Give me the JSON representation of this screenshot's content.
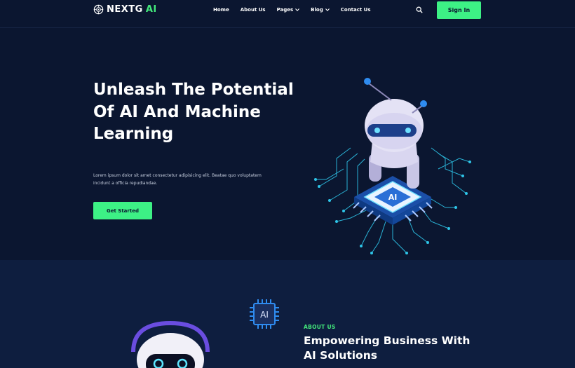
{
  "brand": {
    "name": "NEXTG",
    "suffix": "AI"
  },
  "nav": {
    "items": [
      {
        "label": "Home",
        "has_dropdown": false
      },
      {
        "label": "About Us",
        "has_dropdown": false
      },
      {
        "label": "Pages",
        "has_dropdown": true
      },
      {
        "label": "Blog",
        "has_dropdown": true
      },
      {
        "label": "Contact Us",
        "has_dropdown": false
      }
    ],
    "search_icon": "search-icon",
    "signin_label": "Sign In"
  },
  "hero": {
    "title": "Unleash The Potential Of AI And Machine Learning",
    "description": "Lorem ipsum dolor sit amet consectetur adipisicing elit. Beatae quo voluptatem incidunt a officia repudiandae.",
    "cta_label": "Get Started",
    "chip_label": "AI"
  },
  "about": {
    "eyebrow": "ABOUT US",
    "title": "Empowering Business With AI Solutions",
    "chip_label": "AI"
  },
  "colors": {
    "background": "#0b1630",
    "section_alt": "#0e1e3f",
    "accent": "#3df185",
    "circuit": "#2ec5e8"
  }
}
